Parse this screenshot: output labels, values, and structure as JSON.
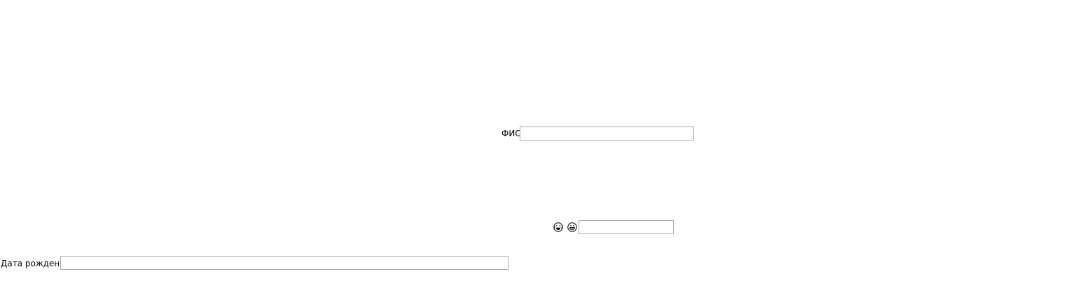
{
  "form": {
    "fio": {
      "label": "ФИО",
      "value": "",
      "placeholder": ""
    },
    "emoji_row": {
      "icons": [
        "face-with-tears-of-joy-icon",
        "grinning-face-icon"
      ],
      "value": "",
      "placeholder": ""
    },
    "birth_date": {
      "label": "Дата рождения",
      "value": "",
      "placeholder": ""
    }
  }
}
